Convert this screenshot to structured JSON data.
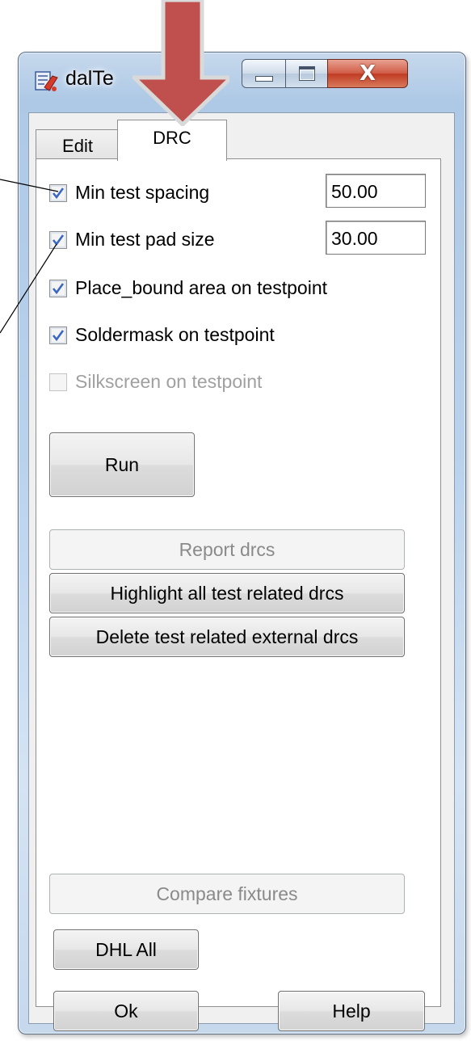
{
  "window": {
    "title": "dalTe",
    "controls": {
      "minimize": "minimize",
      "maximize": "maximize",
      "close": "X"
    }
  },
  "tabs": [
    {
      "label": "Edit",
      "selected": false
    },
    {
      "label": "DRC",
      "selected": true
    }
  ],
  "drc": {
    "min_spacing": {
      "label": "Min test spacing",
      "checked": true,
      "value": "50.00"
    },
    "min_pad": {
      "label": "Min test pad size",
      "checked": true,
      "value": "30.00"
    },
    "place_bound": {
      "label": "Place_bound area on testpoint",
      "checked": true
    },
    "soldermask": {
      "label": "Soldermask on testpoint",
      "checked": true
    },
    "silkscreen": {
      "label": "Silkscreen on testpoint",
      "checked": false,
      "disabled": true
    }
  },
  "buttons": {
    "run": "Run",
    "report": "Report drcs",
    "highlight": "Highlight all test related drcs",
    "delete": "Delete test related external drcs",
    "compare": "Compare fixtures",
    "dhl_all": "DHL All",
    "ok": "Ok",
    "help": "Help"
  },
  "colors": {
    "arrow": "#c0504d",
    "arrow_outline": "#d9d9d9",
    "checkmark": "#3a66c4",
    "close_button": "#c8452e"
  },
  "icons": {
    "app": "pcb-tool-icon",
    "check": "checkmark-icon"
  }
}
